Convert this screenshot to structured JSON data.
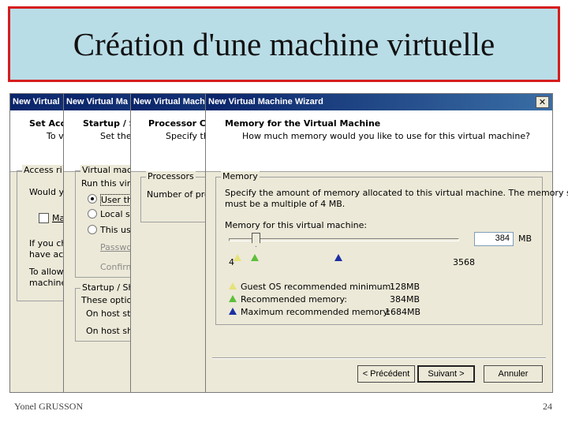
{
  "slide": {
    "title": "Création d'une machine virtuelle",
    "footer_author": "Yonel GRUSSON",
    "page_number": "24"
  },
  "windows": {
    "w1": {
      "title": "New Virtual",
      "header_title": "Set Acce",
      "header_sub": "To v",
      "group_legend": "Access ri",
      "line1": "Would ye",
      "checkbox_label": "Ma",
      "line2": "If you ch",
      "line3": "have acc",
      "line4": "To allow",
      "line5": "machine"
    },
    "w2": {
      "title": "New Virtual Ma",
      "header_title": "Startup / S",
      "header_sub": "Set the",
      "group1_legend": "Virtual mach",
      "line_run": "Run this virtu",
      "radio1": "User tha",
      "radio2": "Local sy",
      "radio3": "This use",
      "password": "Passwo",
      "confirm": "Confirm",
      "group2_legend": "Startup / Sh",
      "options": "These option",
      "on_start": "On host sta",
      "on_shutdown": "On host shu"
    },
    "w3": {
      "title": "New Virtual Mach",
      "header_title": "Processor Co",
      "header_sub": "Specify the",
      "group_legend": "Processors",
      "number_label": "Number of proc"
    },
    "w4": {
      "title": "New Virtual Machine Wizard",
      "close_glyph": "✕",
      "header_title": "Memory for the Virtual Machine",
      "header_sub": "How much memory would you like to use for this virtual machine?",
      "group_legend": "Memory",
      "desc_line1": "Specify the amount of memory allocated to this virtual machine. The memory size",
      "desc_line2": "must be a multiple of 4 MB.",
      "slider_label": "Memory for this virtual machine:",
      "memory_value": "384",
      "memory_unit": "MB",
      "slider_min_label": "4",
      "slider_max_label": "3568",
      "legend": [
        {
          "label": "Guest OS recommended minimum:",
          "value": "128MB",
          "color": "#e6e27a"
        },
        {
          "label": "Recommended memory:",
          "value": "384MB",
          "color": "#5cbf3a"
        },
        {
          "label": "Maximum recommended memory:",
          "value": "1684MB",
          "color": "#1c2fa3"
        }
      ],
      "buttons": {
        "back": "< Précédent",
        "next": "Suivant >",
        "cancel": "Annuler"
      }
    }
  }
}
